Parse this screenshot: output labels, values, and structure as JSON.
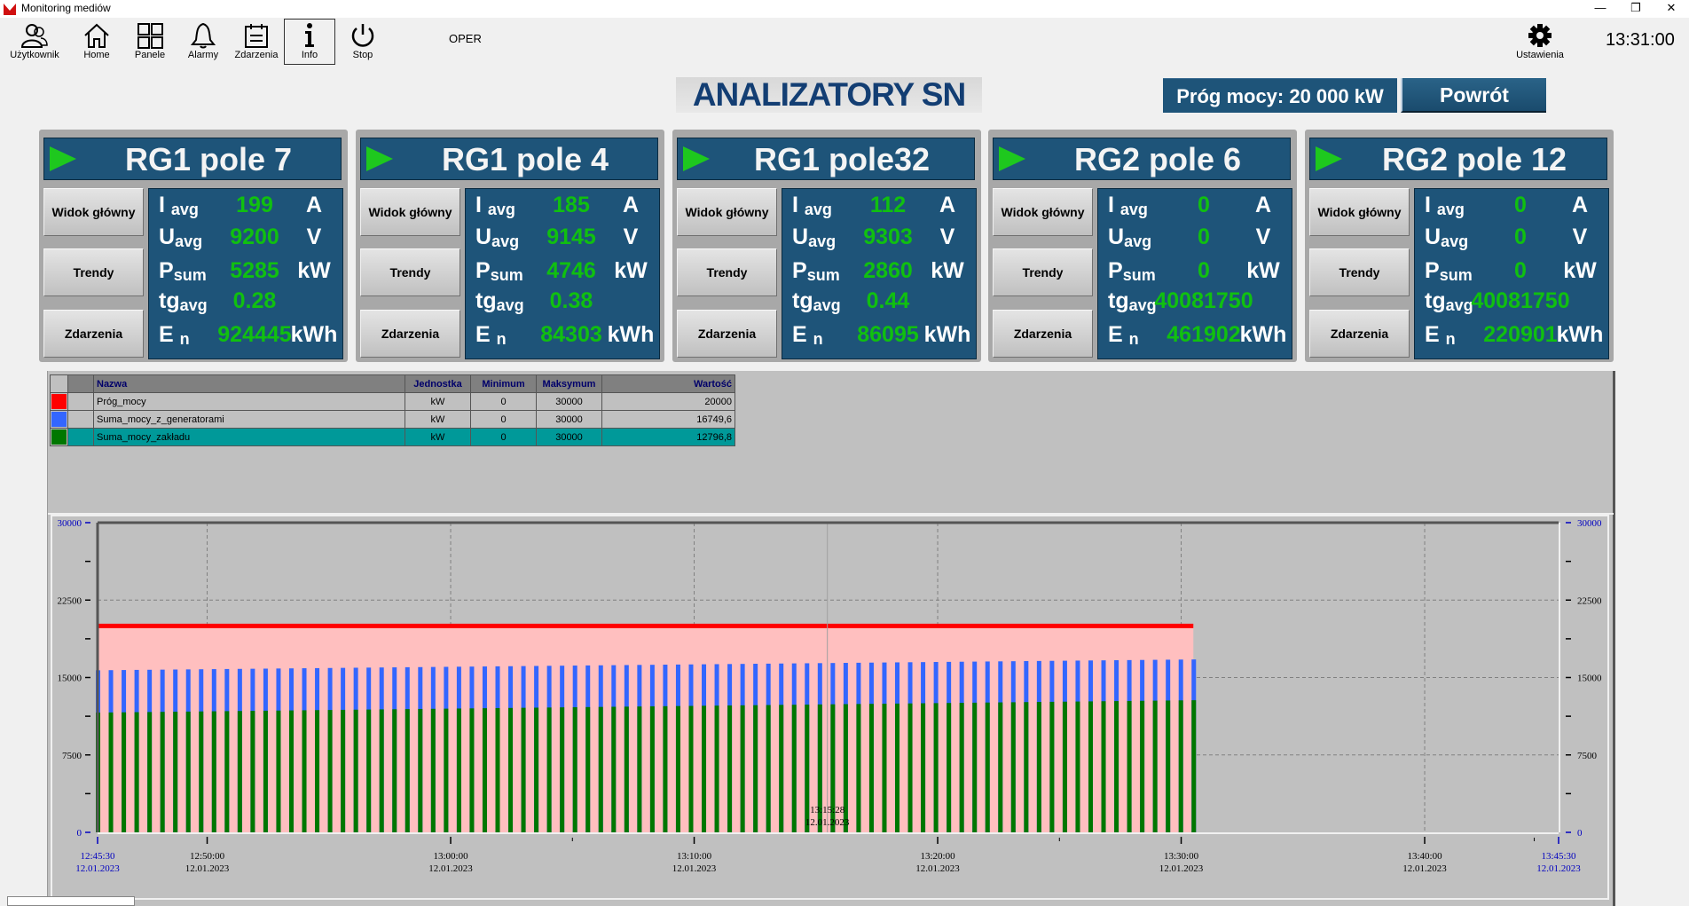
{
  "window": {
    "title": "Monitoring mediów",
    "controls": {
      "minimize": "—",
      "restore": "❐",
      "close": "✕"
    }
  },
  "toolbar": {
    "buttons": [
      {
        "label": "Użytkownik",
        "icon": "user-icon"
      },
      {
        "label": "Home",
        "icon": "home-icon"
      },
      {
        "label": "Panele",
        "icon": "panels-icon"
      },
      {
        "label": "Alarmy",
        "icon": "bell-icon"
      },
      {
        "label": "Zdarzenia",
        "icon": "calendar-icon"
      },
      {
        "label": "Info",
        "icon": "info-icon",
        "active": true
      },
      {
        "label": "Stop",
        "icon": "power-icon"
      }
    ],
    "mode": "OPER",
    "settings_label": "Ustawienia",
    "clock": "13:31:00"
  },
  "header": {
    "title": "ANALIZATORY SN",
    "threshold_label": "Próg mocy:  20 000 kW",
    "back_label": "Powrót"
  },
  "panel_buttons": {
    "main": "Widok główny",
    "trends": "Trendy",
    "events": "Zdarzenia"
  },
  "labels": {
    "i": "I",
    "i_sub": "avg",
    "u": "U",
    "u_sub": "avg",
    "p": "P",
    "p_sub": "sum",
    "tg": "tg",
    "tg_sub": "avg",
    "e": "E",
    "e_sub": "n"
  },
  "units": {
    "i": "A",
    "u": "V",
    "p": "kW",
    "e": "kWh"
  },
  "panels": [
    {
      "title": "RG1 pole 7",
      "i": "199",
      "u": "9200",
      "p": "5285",
      "tg": "0.28",
      "e": "924445"
    },
    {
      "title": "RG1 pole 4",
      "i": "185",
      "u": "9145",
      "p": "4746",
      "tg": "0.38",
      "e": "84303"
    },
    {
      "title": "RG1 pole32",
      "i": "112",
      "u": "9303",
      "p": "2860",
      "tg": "0.44",
      "e": "86095"
    },
    {
      "title": "RG2 pole 6",
      "i": "0",
      "u": "0",
      "p": "0",
      "tg": "40081750",
      "e": "461902"
    },
    {
      "title": "RG2 pole 12",
      "i": "0",
      "u": "0",
      "p": "0",
      "tg": "40081750",
      "e": "220901"
    }
  ],
  "legend": {
    "headers": [
      "Nazwa",
      "Jednostka",
      "Minimum",
      "Maksymum",
      "Wartość"
    ],
    "rows": [
      {
        "color": "#ff0000",
        "name": "Próg_mocy",
        "unit": "kW",
        "min": "0",
        "max": "30000",
        "value": "20000"
      },
      {
        "color": "#3366ff",
        "name": "Suma_mocy_z_generatorami",
        "unit": "kW",
        "min": "0",
        "max": "30000",
        "value": "16749,6"
      },
      {
        "color": "#007700",
        "name": "Suma_mocy_zakładu",
        "unit": "kW",
        "min": "0",
        "max": "30000",
        "value": "12796,8",
        "selected": true
      }
    ]
  },
  "chart_data": {
    "type": "bar",
    "title": "",
    "ylim": [
      0,
      30000
    ],
    "y_ticks": [
      "0",
      "7500",
      "15000",
      "22500",
      "30000"
    ],
    "x_start": {
      "time": "12:45:30",
      "date": "12.01.2023"
    },
    "x_end": {
      "time": "13:45:30",
      "date": "12.01.2023"
    },
    "x_ticks": [
      {
        "time": "12:50:00",
        "date": "12.01.2023"
      },
      {
        "time": "13:00:00",
        "date": "12.01.2023"
      },
      {
        "time": "13:10:00",
        "date": "12.01.2023"
      },
      {
        "time": "13:20:00",
        "date": "12.01.2023"
      },
      {
        "time": "13:30:00",
        "date": "12.01.2023"
      },
      {
        "time": "13:40:00",
        "date": "12.01.2023"
      }
    ],
    "cursor": {
      "time": "13:15:28",
      "date": "12.01.2023"
    },
    "grid": true,
    "data_end_minutes": 45,
    "series": [
      {
        "name": "Próg_mocy",
        "color": "#ff0000",
        "kind": "line",
        "value": 20000,
        "fill": "#ffbfbf"
      },
      {
        "name": "Suma_mocy_z_generatorami",
        "color": "#3366ff",
        "kind": "bar",
        "start": 15700,
        "end": 16750
      },
      {
        "name": "Suma_mocy_zakładu",
        "color": "#007700",
        "kind": "bar",
        "start": 11600,
        "end": 12800
      }
    ],
    "bar_count": 86
  }
}
